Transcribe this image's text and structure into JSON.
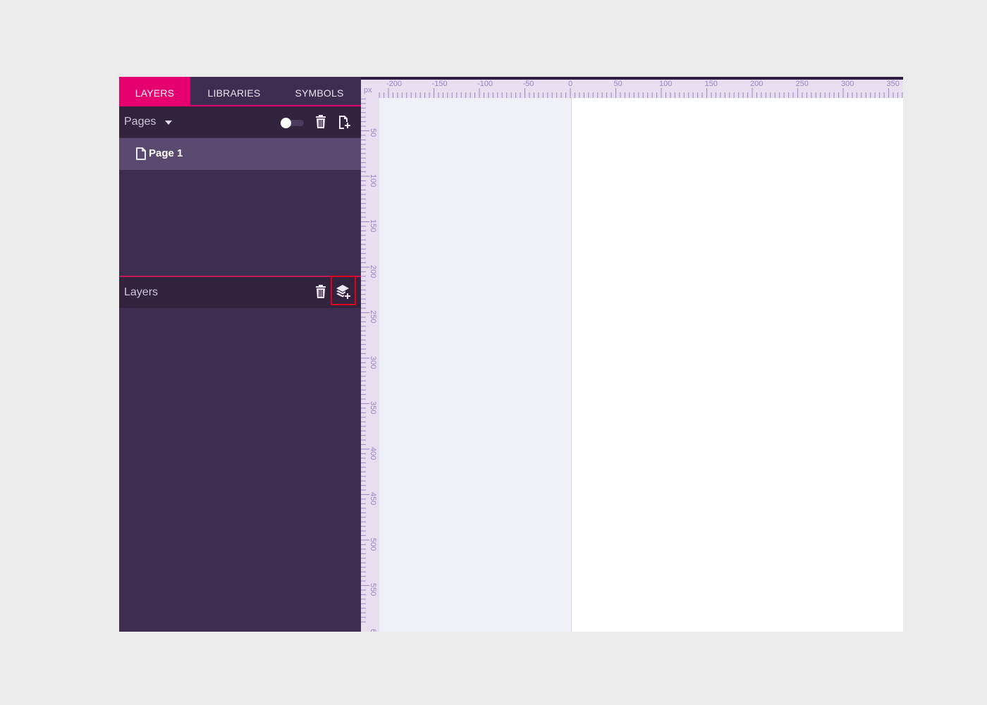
{
  "sidebar": {
    "tabs": [
      {
        "label": "LAYERS"
      },
      {
        "label": "LIBRARIES"
      },
      {
        "label": "SYMBOLS"
      }
    ],
    "active_tab": "LAYERS",
    "pages": {
      "label": "Pages",
      "toggle_on": false,
      "items": [
        {
          "label": "Page 1",
          "selected": true
        }
      ]
    },
    "layers": {
      "label": "Layers"
    }
  },
  "canvas": {
    "unit_label": "px",
    "top_ruler_labels": [
      "-200",
      "-150",
      "-100",
      "-50",
      "0",
      "50",
      "100",
      "150",
      "200",
      "250",
      "300",
      "350"
    ],
    "left_ruler_labels": [
      "50",
      "100",
      "150",
      "200",
      "250",
      "300",
      "350",
      "400",
      "450",
      "500",
      "550",
      "6"
    ]
  },
  "colors": {
    "accent": "#e6006f",
    "sidebar_bg": "#3d2d50",
    "header_bg": "#32233f",
    "selected_row": "#5a4a70",
    "ruler_bg": "#e7def0",
    "ruler_text": "#9b85c4",
    "highlight_box": "#e0001b"
  },
  "icons": {
    "pages_dropdown": "caret-down-icon",
    "pages_toggle": "toggle-icon",
    "pages_delete": "trash-icon",
    "pages_add": "add-page-icon",
    "page_item": "file-icon",
    "layers_delete": "trash-icon",
    "layers_add": "add-layer-icon"
  }
}
